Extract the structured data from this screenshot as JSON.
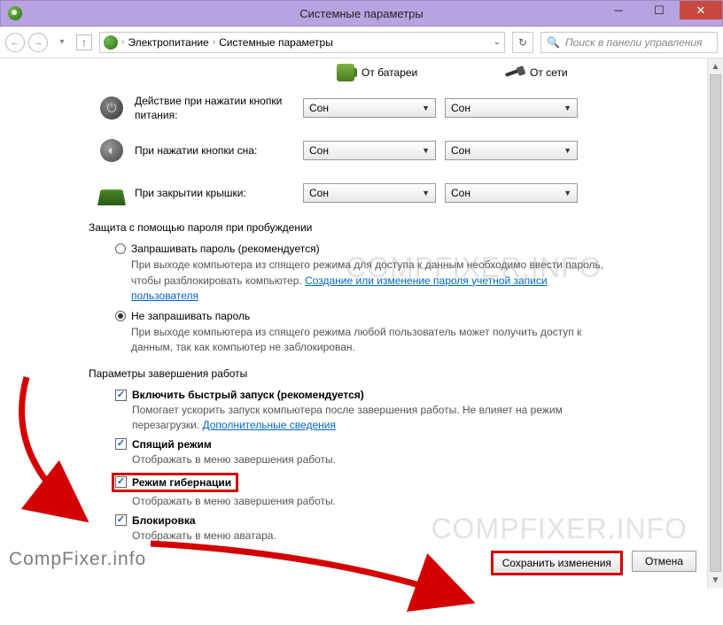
{
  "window": {
    "title": "Системные параметры"
  },
  "breadcrumb": {
    "item1": "Электропитание",
    "item2": "Системные параметры"
  },
  "search": {
    "placeholder": "Поиск в панели управления"
  },
  "sources": {
    "battery": "От батареи",
    "ac": "От сети"
  },
  "settings": {
    "power_button": {
      "label": "Действие при нажатии кнопки питания:",
      "battery": "Сон",
      "ac": "Сон"
    },
    "sleep_button": {
      "label": "При нажатии кнопки сна:",
      "battery": "Сон",
      "ac": "Сон"
    },
    "lid_close": {
      "label": "При закрытии крышки:",
      "battery": "Сон",
      "ac": "Сон"
    }
  },
  "password_section": {
    "heading": "Защита с помощью пароля при пробуждении",
    "require": {
      "label": "Запрашивать пароль (рекомендуется)",
      "desc": "При выходе компьютера из спящего режима для доступа к данным необходимо ввести пароль, чтобы разблокировать компьютер. ",
      "link": "Создание или изменение пароля учетной записи пользователя"
    },
    "no_require": {
      "label": "Не запрашивать пароль",
      "desc": "При выходе компьютера из спящего режима любой пользователь может получить доступ к данным, так как компьютер не заблокирован."
    }
  },
  "shutdown_section": {
    "heading": "Параметры завершения работы",
    "fast_startup": {
      "label": "Включить быстрый запуск (рекомендуется)",
      "desc1": "Помогает ускорить запуск компьютера после завершения работы. Не влияет на режим перезагрузки. ",
      "link": "Дополнительные сведения"
    },
    "sleep": {
      "label": "Спящий режим",
      "desc": "Отображать в меню завершения работы."
    },
    "hibernate": {
      "label": "Режим гибернации",
      "desc": "Отображать в меню завершения работы."
    },
    "lock": {
      "label": "Блокировка",
      "desc": "Отображать в меню аватара."
    }
  },
  "buttons": {
    "save": "Сохранить изменения",
    "cancel": "Отмена"
  },
  "watermark": "compfixer.info",
  "watermark_label": "CompFixer.info"
}
